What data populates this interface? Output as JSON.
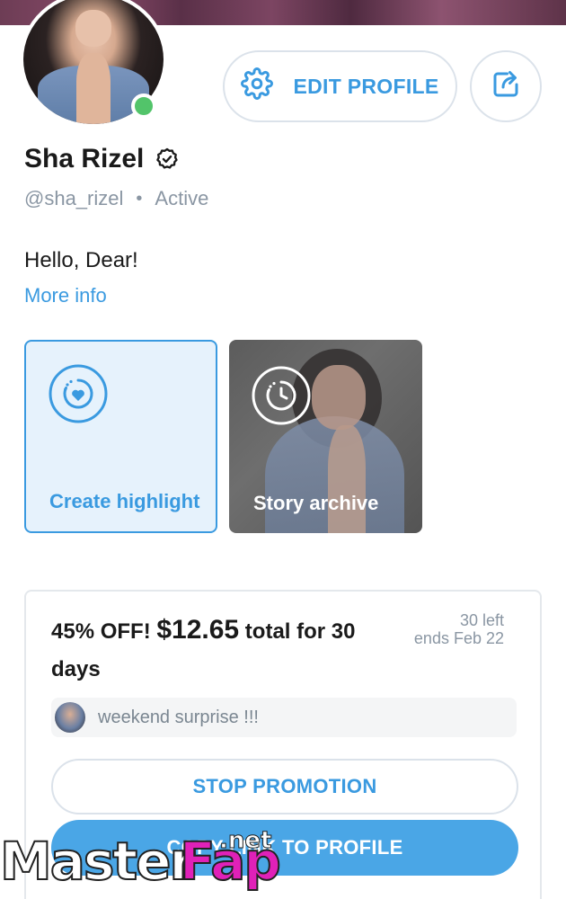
{
  "profile": {
    "name": "Sha Rizel",
    "handle": "@sha_rizel",
    "status": "Active",
    "status_separator": "•",
    "bio": "Hello, Dear!",
    "more_info": "More info",
    "online_color": "#52c46a"
  },
  "actions": {
    "edit_profile": "EDIT PROFILE",
    "edit_icon": "gear-icon",
    "share_icon": "share-icon"
  },
  "highlights": [
    {
      "label": "Create highlight",
      "icon": "heart-circle-icon"
    },
    {
      "label": "Story archive",
      "icon": "clock-history-icon"
    }
  ],
  "promotion": {
    "discount": "45% OFF!",
    "price": "$12.65",
    "terms": "total for 30 days",
    "remaining": "30 left",
    "ends": "ends Feb 22",
    "message": "weekend surprise !!!",
    "stop_button": "STOP PROMOTION",
    "copy_button": "COPY LINK TO PROFILE"
  },
  "watermark": {
    "text_master": "Master",
    "text_fap": "Fap",
    "text_net": ".net"
  },
  "colors": {
    "accent": "#3a9ae0",
    "primary_button": "#4aa6e6",
    "muted_text": "#8a96a3"
  }
}
